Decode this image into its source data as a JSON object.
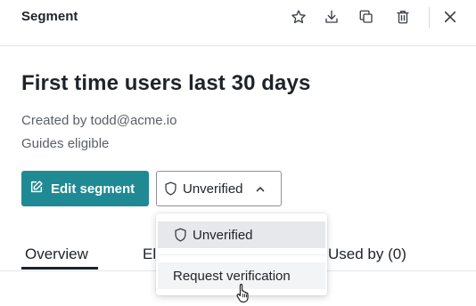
{
  "header": {
    "title": "Segment",
    "icons": [
      "star-icon",
      "download-icon",
      "copy-icon",
      "trash-icon",
      "close-icon"
    ]
  },
  "segment": {
    "title": "First time users last 30 days",
    "created_by": "Created by todd@acme.io",
    "guides": "Guides eligible"
  },
  "actions": {
    "edit_label": "Edit segment",
    "status_label": "Unverified"
  },
  "dropdown": {
    "options": [
      "Unverified",
      "Request verification"
    ],
    "selected": "Unverified"
  },
  "tabs": [
    {
      "label": "Overview",
      "active": true
    },
    {
      "label": "El"
    },
    {
      "label": "Used by (0)"
    }
  ],
  "colors": {
    "accent": "#1f8a93",
    "text": "#1f2329",
    "muted": "#5a5f66"
  }
}
